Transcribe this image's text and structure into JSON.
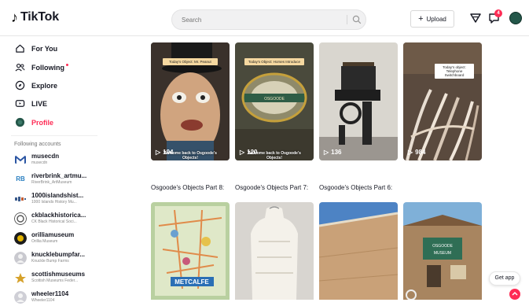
{
  "header": {
    "logo_glyph": "♪",
    "logo_text": "TikTok",
    "search_placeholder": "Search",
    "upload_label": "Upload",
    "inbox_badge": "4",
    "colors": {
      "accent": "#fe2c55"
    }
  },
  "sidebar": {
    "nav": [
      {
        "label": "For You",
        "icon": "home-icon"
      },
      {
        "label": "Following",
        "icon": "users-icon"
      },
      {
        "label": "Explore",
        "icon": "compass-icon"
      },
      {
        "label": "LIVE",
        "icon": "live-icon"
      },
      {
        "label": "Profile",
        "icon": "profile-avatar"
      }
    ],
    "following_title": "Following accounts",
    "accounts": [
      {
        "name": "musecdn",
        "sub": "musecdn"
      },
      {
        "name": "riverbrink_artmu...",
        "sub": "RiverBrink_ArtMuseum"
      },
      {
        "name": "1000islandshist...",
        "sub": "1000 Islands History Mu..."
      },
      {
        "name": "ckblackhistorica...",
        "sub": "CK Black Historical Soci..."
      },
      {
        "name": "orilliamuseum",
        "sub": "Orillia Museum"
      },
      {
        "name": "knucklebumpfar...",
        "sub": "Knuckle Bump Farms"
      },
      {
        "name": "scottishmuseums",
        "sub": "Scottish Museums Feder..."
      },
      {
        "name": "wheeler1104",
        "sub": "Wheeler1104"
      }
    ]
  },
  "videos": [
    {
      "views": "194",
      "title": "Osgoode's Objects Part 8:",
      "tag": "Today's Object: Mr. Peanut",
      "caption": "Welcome back to Osgoode's Objects!"
    },
    {
      "views": "120",
      "title": "Osgoode's Objects Part 7:",
      "tag": "Today's Object: Horses Introduce",
      "caption": "Welcome back to Osgoode's Objects!"
    },
    {
      "views": "136",
      "title": "Osgoode's Objects Part 6:",
      "tag": "",
      "caption": ""
    },
    {
      "views": "984",
      "title": "",
      "tag": "Today's object: Telephone Switchboard",
      "caption": ""
    },
    {
      "views": "",
      "title": "",
      "tag": "",
      "caption": "METCALFE"
    },
    {
      "views": "",
      "title": "",
      "tag": "",
      "caption": ""
    },
    {
      "views": "",
      "title": "",
      "tag": "",
      "caption": ""
    },
    {
      "views": "",
      "title": "",
      "tag": "",
      "caption": "OSGOODE TOWNSHIP MUSEUM"
    }
  ],
  "get_app_label": "Get app"
}
